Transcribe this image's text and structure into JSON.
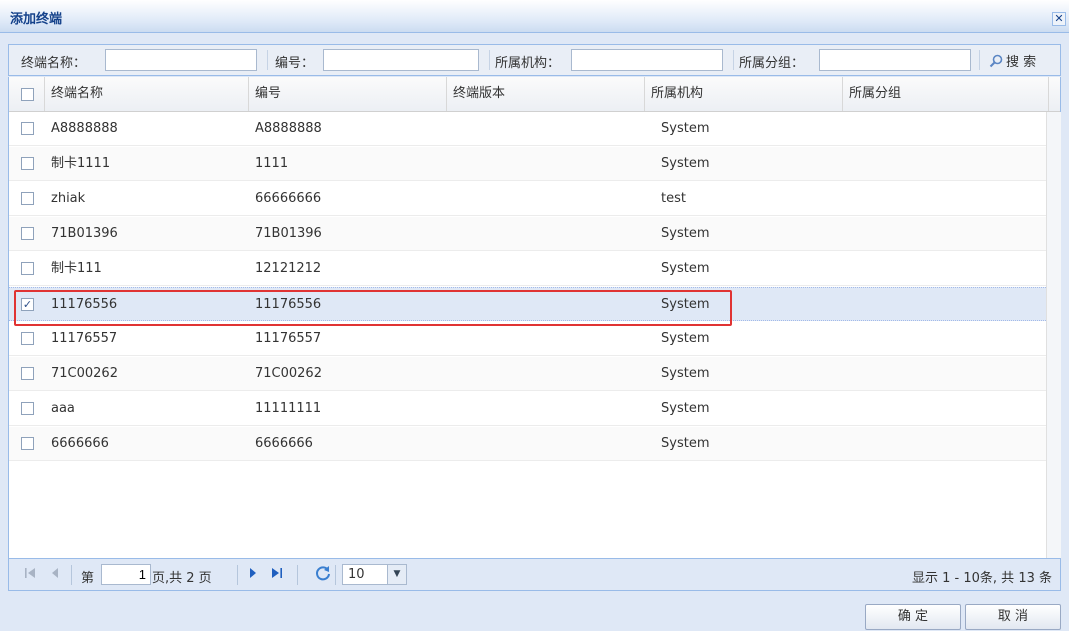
{
  "window": {
    "title": "添加终端",
    "close_glyph": "✕"
  },
  "search": {
    "fields": [
      {
        "label": "终端名称：",
        "value": "",
        "placeholder": ""
      },
      {
        "label": "编号：",
        "value": "",
        "placeholder": ""
      },
      {
        "label": "所属机构：",
        "value": "",
        "placeholder": ""
      },
      {
        "label": "所属分组：",
        "value": "",
        "placeholder": ""
      }
    ],
    "button_label": "搜 索",
    "button_icon": "search-icon"
  },
  "grid": {
    "columns": [
      "终端名称",
      "编号",
      "终端版本",
      "所属机构",
      "所属分组"
    ],
    "rows": [
      {
        "checked": false,
        "name": "A8888888",
        "code": "A8888888",
        "version": "",
        "org": "System",
        "group": ""
      },
      {
        "checked": false,
        "name": "制卡1111",
        "code": "1111",
        "version": "",
        "org": "System",
        "group": ""
      },
      {
        "checked": false,
        "name": "zhiak",
        "code": "66666666",
        "version": "",
        "org": "test",
        "group": ""
      },
      {
        "checked": false,
        "name": "71B01396",
        "code": "71B01396",
        "version": "",
        "org": "System",
        "group": ""
      },
      {
        "checked": false,
        "name": "制卡111",
        "code": "12121212",
        "version": "",
        "org": "System",
        "group": ""
      },
      {
        "checked": true,
        "name": "11176556",
        "code": "11176556",
        "version": "",
        "org": "System",
        "group": ""
      },
      {
        "checked": false,
        "name": "11176557",
        "code": "11176557",
        "version": "",
        "org": "System",
        "group": ""
      },
      {
        "checked": false,
        "name": "71C00262",
        "code": "71C00262",
        "version": "",
        "org": "System",
        "group": ""
      },
      {
        "checked": false,
        "name": "aaa",
        "code": "11111111",
        "version": "",
        "org": "System",
        "group": ""
      },
      {
        "checked": false,
        "name": "6666666",
        "code": "6666666",
        "version": "",
        "org": "System",
        "group": ""
      }
    ],
    "check_glyph": "✓"
  },
  "pager": {
    "first_icon": "first-page-icon",
    "prev_icon": "prev-page-icon",
    "next_icon": "next-page-icon",
    "last_icon": "last-page-icon",
    "refresh_icon": "refresh-icon",
    "page_prefix": "第",
    "page_value": "1",
    "page_suffix": "页,共 2 页",
    "page_size": "10",
    "info": "显示 1 - 10条, 共 13 条"
  },
  "footer": {
    "ok_label": "确 定",
    "cancel_label": "取 消"
  }
}
